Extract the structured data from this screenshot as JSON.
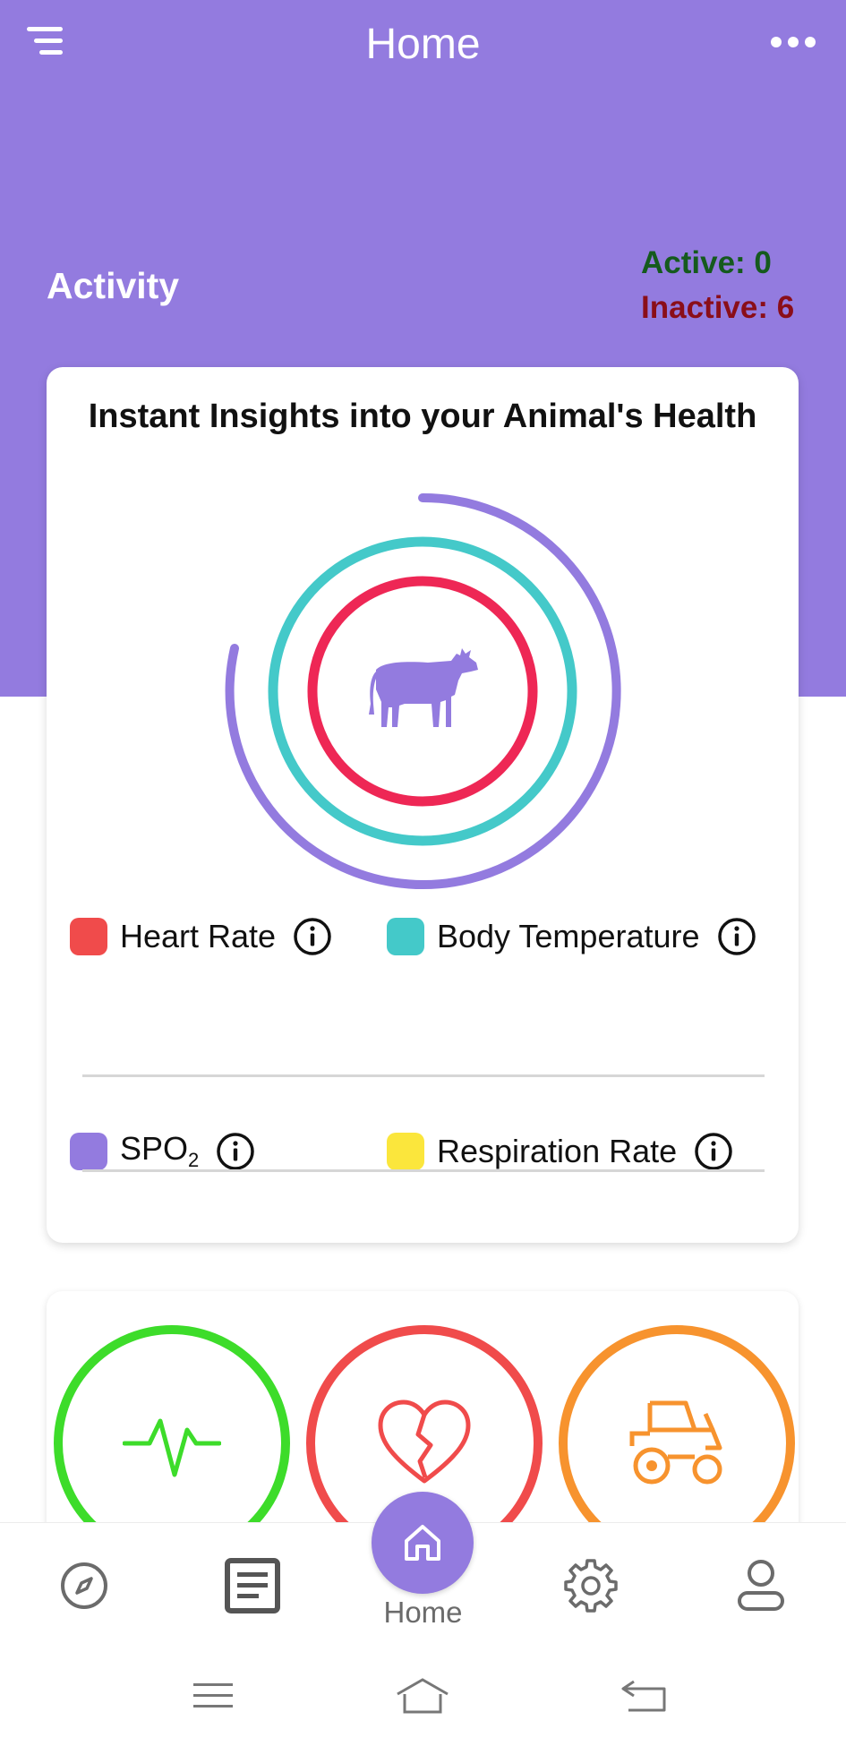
{
  "header": {
    "title": "Home",
    "menu_icon": "filter-menu-icon",
    "more_icon": "more-dots-icon"
  },
  "activity": {
    "label": "Activity",
    "active": "Active: 0",
    "inactive": "Inactive: 6"
  },
  "insights": {
    "title": "Instant Insights into your Animal's Health",
    "center_icon": "cow-icon",
    "legend": [
      {
        "label": "Heart Rate",
        "color": "#f04b4b"
      },
      {
        "label": "Body Temperature",
        "color": "#44c9c9"
      },
      {
        "label": "SPO",
        "subscript": "2",
        "color": "#937bdf"
      },
      {
        "label": "Respiration Rate",
        "color": "#fbe63c"
      }
    ],
    "rings": [
      {
        "metric": "SPO2",
        "color": "#937bdf",
        "fill": 0.75
      },
      {
        "metric": "Body Temperature",
        "color": "#44c9c9",
        "fill": 1.0
      },
      {
        "metric": "Heart Rate",
        "color": "#ee2755",
        "fill": 1.0
      }
    ]
  },
  "status_tiles": [
    {
      "icon": "heartbeat-pulse-icon",
      "color": "#3ddc2a"
    },
    {
      "icon": "broken-heart-icon",
      "color": "#f04b4b"
    },
    {
      "icon": "tractor-icon",
      "color": "#f7932e"
    }
  ],
  "bottom_nav": {
    "items": [
      {
        "icon": "compass-icon"
      },
      {
        "icon": "document-icon"
      },
      {
        "icon": "home-icon",
        "label": "Home",
        "active": true
      },
      {
        "icon": "settings-gear-icon"
      },
      {
        "icon": "profile-icon"
      }
    ],
    "accent": "#937bdf"
  },
  "system_nav": {
    "buttons": [
      "recent-apps-icon",
      "system-home-icon",
      "back-icon"
    ]
  },
  "colors": {
    "primary": "#937bdf",
    "active_text": "#155a1d",
    "inactive_text": "#8a0e19"
  }
}
